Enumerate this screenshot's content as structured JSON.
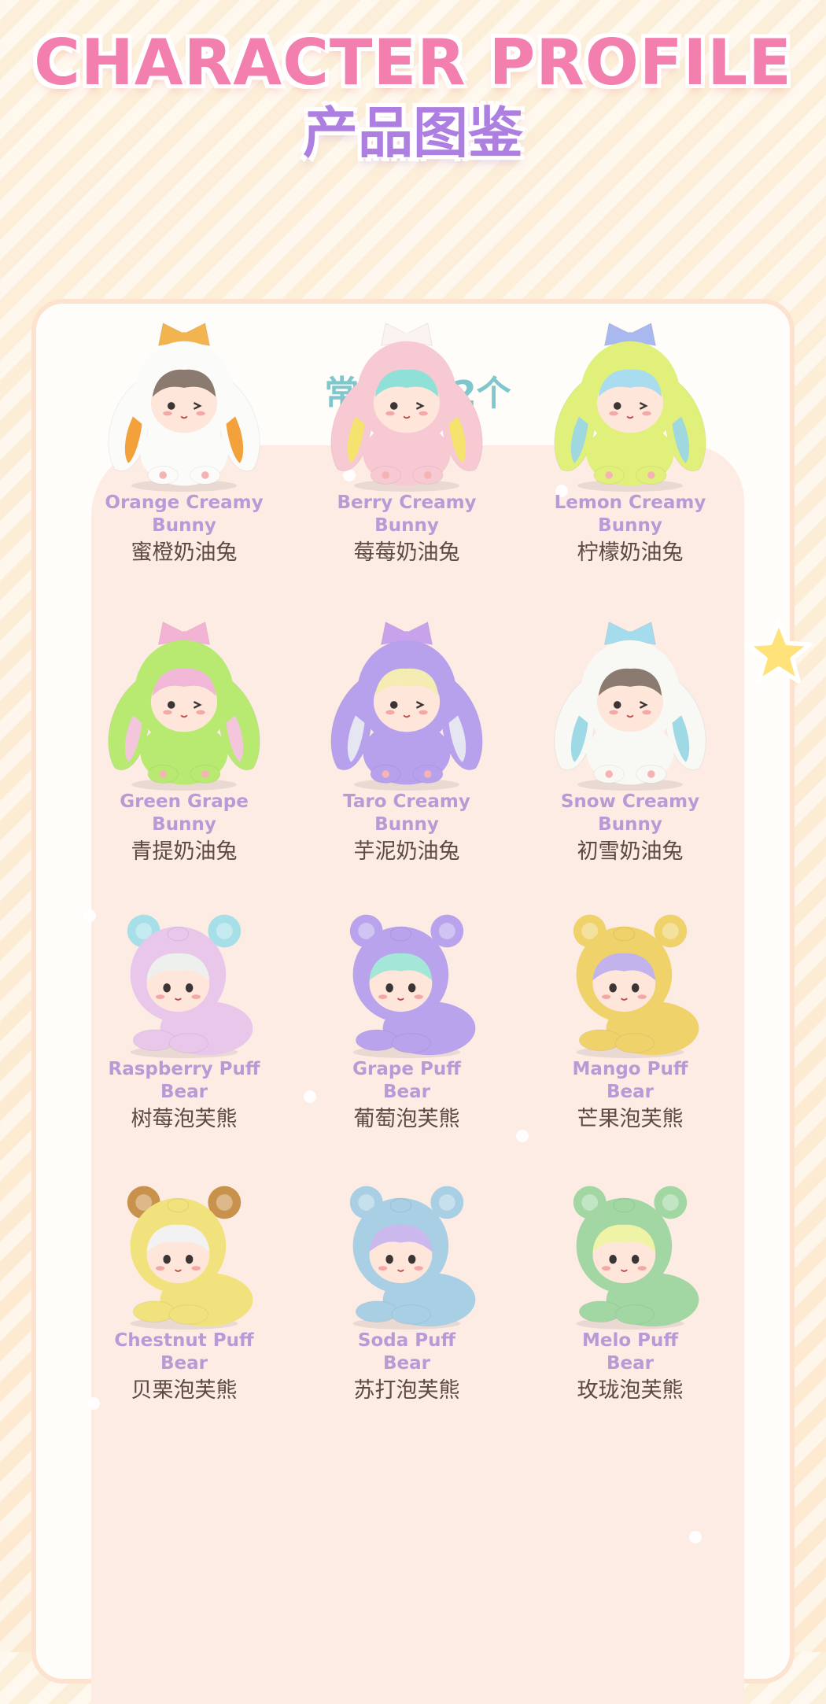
{
  "header": {
    "title_en": "CHARACTER PROFILE",
    "title_cn": "产品图鉴"
  },
  "section": {
    "title": "常规款12个"
  },
  "items": [
    {
      "name_en_1": "Orange Creamy",
      "name_en_2": "Bunny",
      "name_cn": "蜜橙奶油兔",
      "type": "bunny",
      "body": "#fbfbfa",
      "hair": "#8b7a70",
      "ear": "#f3a13b",
      "bow": "#f2b44f"
    },
    {
      "name_en_1": "Berry Creamy",
      "name_en_2": "Bunny",
      "name_cn": "莓莓奶油兔",
      "type": "bunny",
      "body": "#f6c9d3",
      "hair": "#8fe0d6",
      "ear": "#f4e36e",
      "bow": "#fbf2f2"
    },
    {
      "name_en_1": "Lemon Creamy",
      "name_en_2": "Bunny",
      "name_cn": "柠檬奶油兔",
      "type": "bunny",
      "body": "#e0f07a",
      "hair": "#a9dcef",
      "ear": "#9fd9df",
      "bow": "#a9b8ee"
    },
    {
      "name_en_1": "Green Grape",
      "name_en_2": "Bunny",
      "name_cn": "青提奶油兔",
      "type": "bunny",
      "body": "#b8ea72",
      "hair": "#f1b7d6",
      "ear": "#f3c6dc",
      "bow": "#f3b3d4"
    },
    {
      "name_en_1": "Taro Creamy",
      "name_en_2": "Bunny",
      "name_cn": "芋泥奶油兔",
      "type": "bunny",
      "body": "#b7a1ec",
      "hair": "#f4ecb2",
      "ear": "#e6e6f2",
      "bow": "#c9a2ec"
    },
    {
      "name_en_1": "Snow Creamy",
      "name_en_2": "Bunny",
      "name_cn": "初雪奶油兔",
      "type": "bunny",
      "body": "#f8f8f4",
      "hair": "#8b7a70",
      "ear": "#9fd9e6",
      "bow": "#a4dcee"
    },
    {
      "name_en_1": "Raspberry Puff",
      "name_en_2": "Bear",
      "name_cn": "树莓泡芙熊",
      "type": "bear",
      "body": "#e8c7ea",
      "hair": "#eef0ee",
      "ear": "#a6dfe8",
      "bow": "#a6dfe8"
    },
    {
      "name_en_1": "Grape Puff",
      "name_en_2": "Bear",
      "name_cn": "葡萄泡芙熊",
      "type": "bear",
      "body": "#b9a3ec",
      "hair": "#a4e6d8",
      "ear": "#b9a3ec",
      "bow": "#b9a3ec"
    },
    {
      "name_en_1": "Mango Puff",
      "name_en_2": "Bear",
      "name_cn": "芒果泡芙熊",
      "type": "bear",
      "body": "#efd26a",
      "hair": "#c3b3ec",
      "ear": "#efd26a",
      "bow": "#efd26a"
    },
    {
      "name_en_1": "Chestnut Puff",
      "name_en_2": "Bear",
      "name_cn": "贝栗泡芙熊",
      "type": "bear",
      "body": "#f2e27e",
      "hair": "#f2f2f2",
      "ear": "#c9924c",
      "bow": "#c9924c"
    },
    {
      "name_en_1": "Soda Puff",
      "name_en_2": "Bear",
      "name_cn": "苏打泡芙熊",
      "type": "bear",
      "body": "#a9cfe4",
      "hair": "#cbb8ec",
      "ear": "#a9cfe4",
      "bow": "#a9cfe4"
    },
    {
      "name_en_1": "Melo Puff",
      "name_en_2": "Bear",
      "name_cn": "玫珑泡芙熊",
      "type": "bear",
      "body": "#a2d7a4",
      "hair": "#eef3a6",
      "ear": "#a2d7a4",
      "bow": "#a2d7a4"
    }
  ],
  "colors": {
    "title_pink": "#f27fae",
    "title_purple": "#ad7fe0",
    "section_teal": "#7fc7cd",
    "label_purple": "#b99ad6",
    "label_brown": "#5d4a43"
  }
}
